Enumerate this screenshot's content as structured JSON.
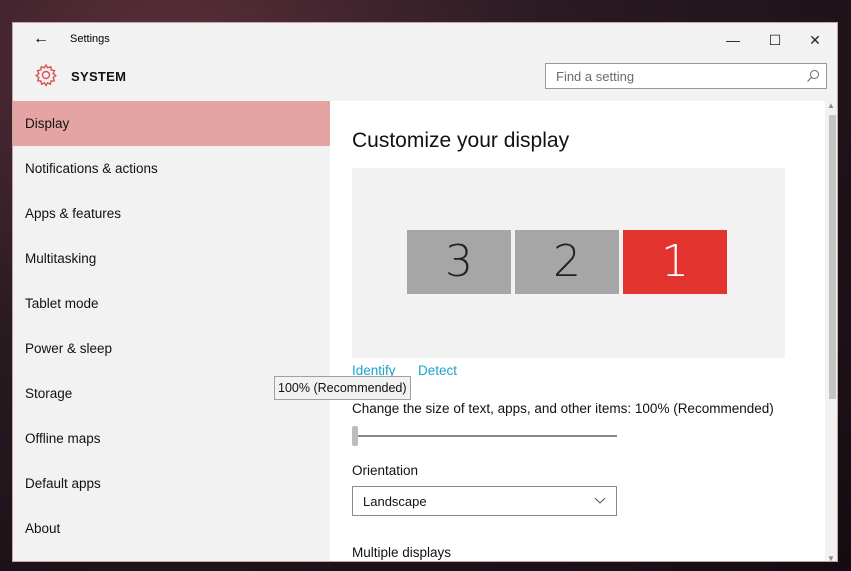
{
  "window": {
    "back_glyph": "←",
    "title": "Settings",
    "controls": {
      "minimize": "—",
      "maximize": "☐",
      "close": "✕"
    }
  },
  "header": {
    "section": "SYSTEM",
    "search_placeholder": "Find a setting",
    "accent": "#d9534f"
  },
  "sidebar": {
    "items": [
      {
        "label": "Display",
        "selected": true
      },
      {
        "label": "Notifications & actions"
      },
      {
        "label": "Apps & features"
      },
      {
        "label": "Multitasking"
      },
      {
        "label": "Tablet mode"
      },
      {
        "label": "Power & sleep"
      },
      {
        "label": "Storage"
      },
      {
        "label": "Offline maps"
      },
      {
        "label": "Default apps"
      },
      {
        "label": "About"
      }
    ]
  },
  "content": {
    "title": "Customize your display",
    "monitors": [
      {
        "label": "3"
      },
      {
        "label": "2"
      },
      {
        "label": "1",
        "active": true
      }
    ],
    "identify": "Identify",
    "detect": "Detect",
    "tooltip": "100% (Recommended)",
    "scale_label": "Change the size of text, apps, and other items: 100% (Recommended)",
    "scale_value": 0.0,
    "orientation_label": "Orientation",
    "orientation_value": "Landscape",
    "multiple_displays_label": "Multiple displays"
  },
  "colors": {
    "selected_nav": "#e5a4a4",
    "active_monitor": "#e2332f",
    "inactive_monitor": "#a6a6a6",
    "link": "#1aa3c8"
  }
}
